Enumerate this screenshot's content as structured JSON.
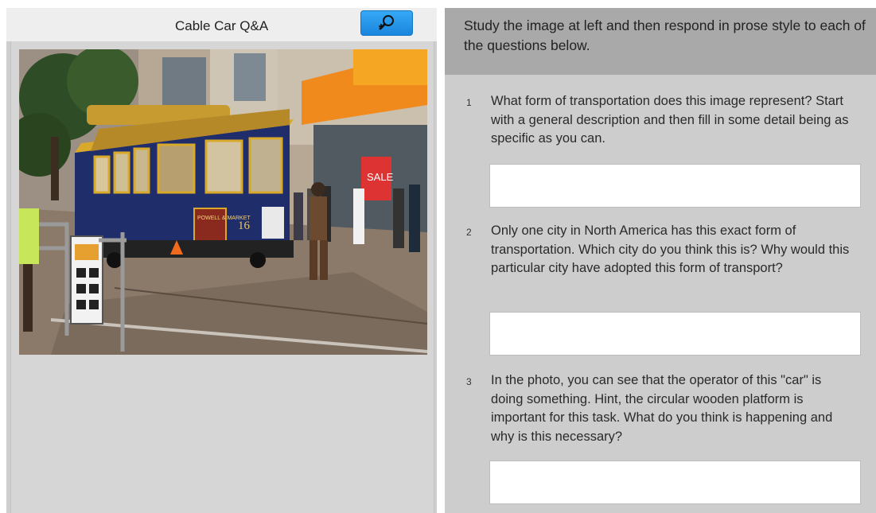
{
  "left_panel": {
    "title": "Cable Car Q&A",
    "zoom_icon": "magnifier-plus-icon",
    "photo": {
      "sign_top": "POWELL & MARKET",
      "car_number": "16",
      "shop_sign": "SALE",
      "colors": {
        "car_body": "#1f2d6b",
        "car_trim": "#d8a92a",
        "storefront": "#f08a1c"
      }
    }
  },
  "right_panel": {
    "instructions": "Study the image at left and then respond in prose style to each of the questions below.",
    "questions": [
      {
        "number": "1",
        "text": "What form of transportation does this image represent? Start with a general description and then fill in some detail being as specific as you can.",
        "answer": ""
      },
      {
        "number": "2",
        "text": "Only one city in North America has this exact form of transportation.  Which city do you think this is?    Why would this particular city have adopted this form of transport?",
        "answer": ""
      },
      {
        "number": "3",
        "text": "In the photo, you can see that the operator of this \"car\" is doing something.   Hint, the circular wooden platform is important for this task.   What do you think is happening and why is this necessary?",
        "answer": ""
      }
    ]
  }
}
